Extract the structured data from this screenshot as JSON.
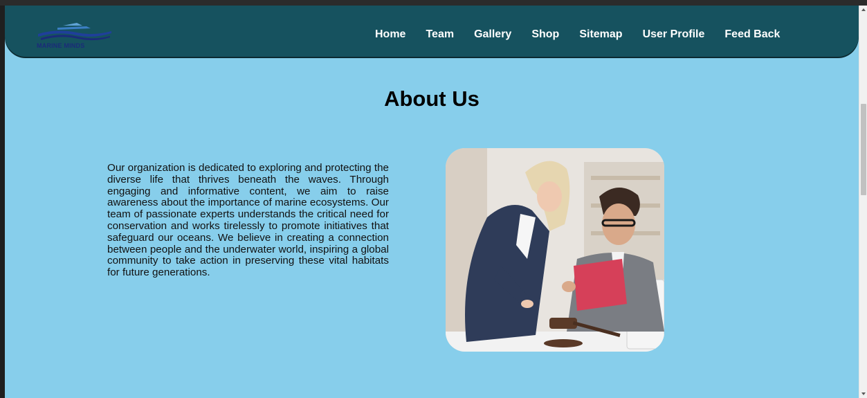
{
  "brand": {
    "name": "MARINE MINDS"
  },
  "nav": {
    "items": [
      {
        "label": "Home"
      },
      {
        "label": "Team"
      },
      {
        "label": "Gallery"
      },
      {
        "label": "Shop"
      },
      {
        "label": "Sitemap"
      },
      {
        "label": "User Profile"
      },
      {
        "label": "Feed Back"
      }
    ]
  },
  "about": {
    "title": "About Us",
    "body": "Our organization is dedicated to exploring and protecting the diverse life that thrives beneath the waves. Through engaging and informative content, we aim to raise awareness about the importance of marine ecosystems. Our team of passionate experts understands the critical need for conservation and works tirelessly to promote initiatives that safeguard our oceans. We believe in creating a connection between people and the underwater world, inspiring a global community to take action in preserving these vital habitats for future generations."
  },
  "colors": {
    "navbar": "#16525f",
    "page_background": "#87ceeb",
    "logo_text": "#1b2b7a"
  }
}
